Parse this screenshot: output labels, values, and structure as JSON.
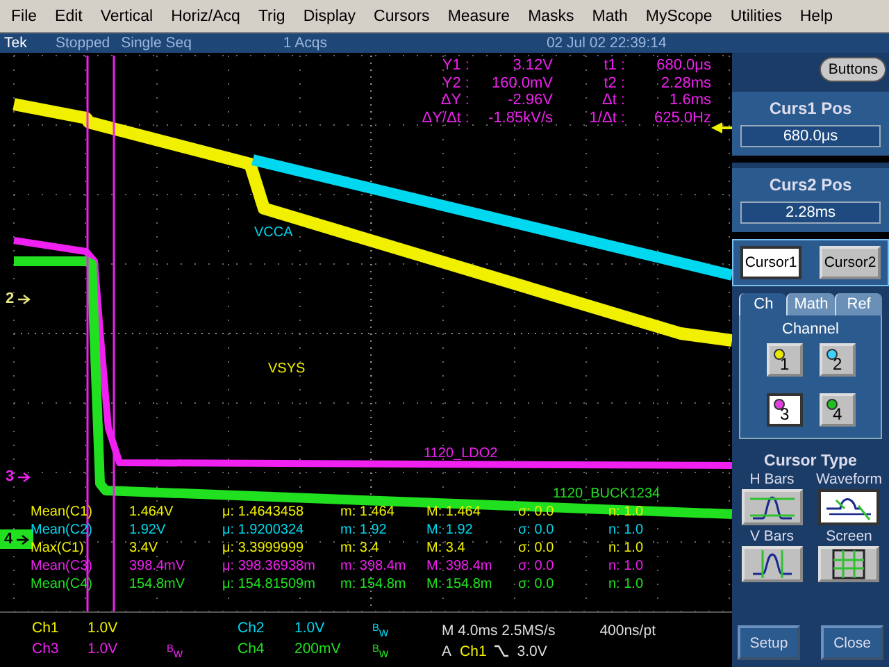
{
  "menu": [
    "File",
    "Edit",
    "Vertical",
    "Horiz/Acq",
    "Trig",
    "Display",
    "Cursors",
    "Measure",
    "Masks",
    "Math",
    "MyScope",
    "Utilities",
    "Help"
  ],
  "status": {
    "brand": "Tek",
    "state": "Stopped",
    "mode": "Single Seq",
    "acqs": "1 Acqs",
    "datetime": "02 Jul 02 22:39:14"
  },
  "display": {
    "trace_labels": [
      {
        "text": "VCCA",
        "color": "#00d8f0"
      },
      {
        "text": "VSYS",
        "color": "#f0f000"
      },
      {
        "text": "1120_LDO2",
        "color": "#f020f0"
      },
      {
        "text": "1120_BUCK1234",
        "color": "#20e020"
      }
    ],
    "markers": [
      {
        "text": "2",
        "color": "#e8e880"
      },
      {
        "text": "3",
        "color": "#f020f0"
      },
      {
        "text": "4",
        "color": "#20e020"
      }
    ],
    "cursor_readout": [
      {
        "label": "Y1 :",
        "value": "3.12V",
        "label2": "t1 :",
        "value2": "680.0μs"
      },
      {
        "label": "Y2 :",
        "value": "160.0mV",
        "label2": "t2 :",
        "value2": "2.28ms"
      },
      {
        "label": "ΔY :",
        "value": "-2.96V",
        "label2": "Δt :",
        "value2": "1.6ms"
      },
      {
        "label": "ΔY/Δt :",
        "value": "-1.85kV/s",
        "label2": "1/Δt :",
        "value2": "625.0Hz"
      }
    ],
    "measurements": [
      {
        "name": "Mean(C1)",
        "value": "1.464V",
        "mean": "μ: 1.4643458",
        "min": "m: 1.464",
        "max": "M: 1.464",
        "sigma": "σ: 0.0",
        "n": "n: 1.0",
        "color": "#f0f000"
      },
      {
        "name": "Mean(C2)",
        "value": "1.92V",
        "mean": "μ: 1.9200324",
        "min": "m: 1.92",
        "max": "M: 1.92",
        "sigma": "σ: 0.0",
        "n": "n: 1.0",
        "color": "#00d8f0"
      },
      {
        "name": "Max(C1)",
        "value": "3.4V",
        "mean": "μ: 3.3999999",
        "min": "m: 3.4",
        "max": "M: 3.4",
        "sigma": "σ: 0.0",
        "n": "n: 1.0",
        "color": "#f0f000"
      },
      {
        "name": "Mean(C3)",
        "value": "398.4mV",
        "mean": "μ: 398.36938m",
        "min": "m: 398.4m",
        "max": "M: 398.4m",
        "sigma": "σ: 0.0",
        "n": "n: 1.0",
        "color": "#f020f0"
      },
      {
        "name": "Mean(C4)",
        "value": "154.8mV",
        "mean": "μ: 154.81509m",
        "min": "m: 154.8m",
        "max": "M: 154.8m",
        "sigma": "σ: 0.0",
        "n": "n: 1.0",
        "color": "#20e020"
      }
    ]
  },
  "readout": {
    "channels": [
      {
        "name": "Ch1",
        "scale": "1.0V",
        "color": "#f0f000"
      },
      {
        "name": "Ch2",
        "scale": "1.0V",
        "bw": "$^{B}$w",
        "color": "#00d8f0"
      },
      {
        "name": "Ch3",
        "scale": "1.0V",
        "bw": "$^{B}$w",
        "color": "#f020f0"
      },
      {
        "name": "Ch4",
        "scale": "200mV",
        "bw": "$^{B}$w",
        "color": "#20e020"
      }
    ],
    "timebase": "M 4.0ms 2.5MS/s",
    "record": "400ns/pt",
    "trigger": {
      "type": "A",
      "source": "Ch1",
      "level": "3.0V"
    }
  },
  "panel": {
    "buttons_label": "Buttons",
    "positions": [
      {
        "title": "Curs1 Pos",
        "value": "680.0μs"
      },
      {
        "title": "Curs2 Pos",
        "value": "2.28ms"
      }
    ],
    "cursors": [
      {
        "label": "Cursor1",
        "selected": true
      },
      {
        "label": "Cursor2",
        "selected": false
      }
    ],
    "tabs": [
      {
        "label": "Ch",
        "selected": true
      },
      {
        "label": "Math",
        "selected": false
      },
      {
        "label": "Ref",
        "selected": false
      }
    ],
    "channel_title": "Channel",
    "channels": [
      {
        "label": "1",
        "color": "#e8e800",
        "selected": false
      },
      {
        "label": "2",
        "color": "#40d0ff",
        "selected": false
      },
      {
        "label": "3",
        "color": "#e040e0",
        "selected": true
      },
      {
        "label": "4",
        "color": "#20c020",
        "selected": false
      }
    ],
    "type_title": "Cursor Type",
    "types": [
      {
        "label": "H Bars",
        "kind": "hbars",
        "selected": false
      },
      {
        "label": "Waveform",
        "kind": "waveform",
        "selected": true
      },
      {
        "label": "V Bars",
        "kind": "vbars",
        "selected": false
      },
      {
        "label": "Screen",
        "kind": "screen",
        "selected": false
      }
    ],
    "actions": [
      "Setup",
      "Close"
    ]
  }
}
